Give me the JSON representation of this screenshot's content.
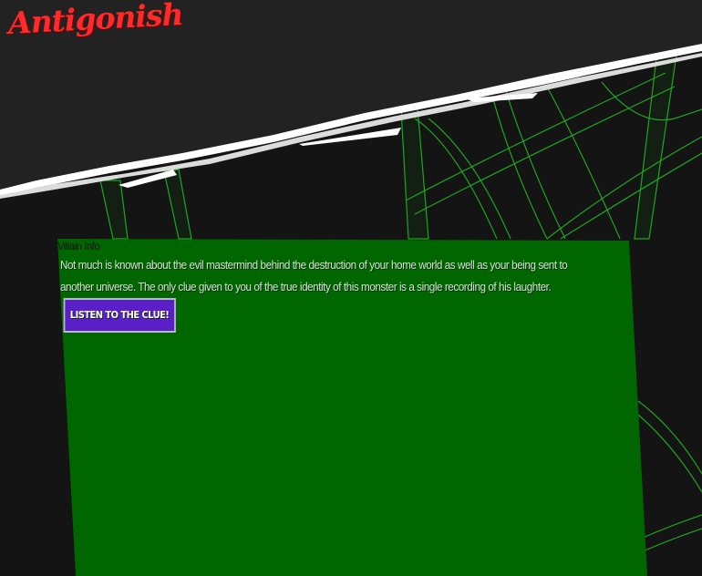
{
  "brand": {
    "logo_text": "Antigonish"
  },
  "panel": {
    "title": "Villain Info",
    "body": "Not much is known about the evil mastermind behind the destruction of your home world as well as your being sent to another universe. The only clue given to you of the true identity of this monster is a single recording of his laughter.",
    "clue_button_label": "LISTEN TO THE CLUE!"
  },
  "colors": {
    "panel_bg": "#006600",
    "logo": "#ff2a2a",
    "button_bg": "#5b1fc8",
    "web_lines": "#1fa61f"
  }
}
